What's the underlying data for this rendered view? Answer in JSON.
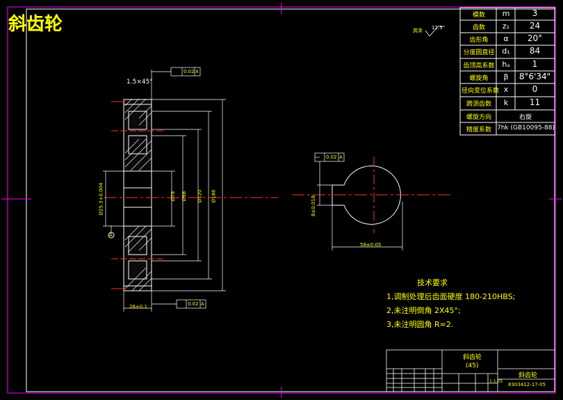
{
  "title": "斜齿轮",
  "surface_note": {
    "prefix": "其余",
    "value": "12.5"
  },
  "param_table": [
    {
      "name": "模数",
      "sym": "m",
      "val": "3"
    },
    {
      "name": "齿数",
      "sym": "z₁",
      "val": "24"
    },
    {
      "name": "齿形角",
      "sym": "α",
      "val": "20°"
    },
    {
      "name": "分度圆直径",
      "sym": "d₁",
      "val": "84"
    },
    {
      "name": "齿顶高系数",
      "sym": "hₐ",
      "val": "1"
    },
    {
      "name": "螺旋角",
      "sym": "β",
      "val": "8°6'34\""
    },
    {
      "name": "径向变位系数",
      "sym": "x",
      "val": "0"
    },
    {
      "name": "跨测齿数",
      "sym": "k",
      "val": "11"
    },
    {
      "name": "螺旋方向",
      "sym": "",
      "val": "右旋"
    },
    {
      "name": "精度系数",
      "sym": "",
      "val": "7hk (GB10095-88)"
    }
  ],
  "dims": {
    "chamfer": "1.5×45°",
    "tol1": "0.02",
    "tol2": "0.02",
    "tol3": "0.02",
    "datum": "A",
    "bore": "Ø25.3+0.004",
    "d1": "Ø78",
    "d2": "Ø98",
    "d3": "Ø120",
    "d4": "Ø186",
    "width": "26±0.1",
    "key_h": "8±0.018",
    "key_w": "58±0.05"
  },
  "tech": {
    "heading": "技术要求",
    "lines": [
      "1,调制处理后齿面硬度 180-210HBS;",
      "2,未注明倒角 2X45°;",
      "3,未注明圆角 R=2."
    ]
  },
  "title_block": {
    "part": "斜齿轮",
    "material": "(45)",
    "name_right": "斜齿轮",
    "code": "8303412-17-05",
    "scale": "1:1.25"
  }
}
